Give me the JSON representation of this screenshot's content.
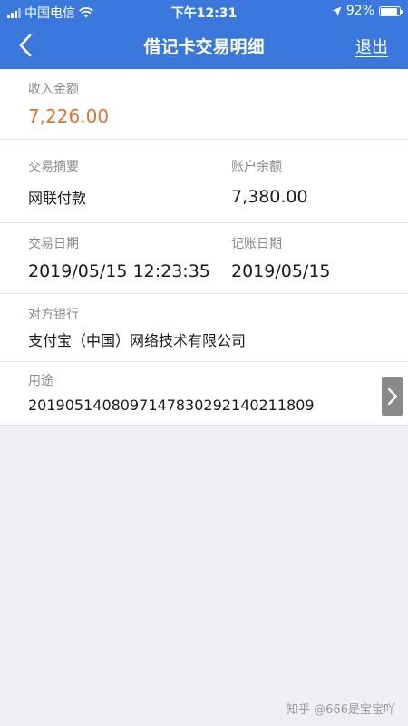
{
  "status_bar": {
    "carrier": "中国电信",
    "time": "下午12:31",
    "battery": "92%",
    "battery_level": 0.92
  },
  "nav": {
    "title": "借记卡交易明细",
    "exit": "退出"
  },
  "detail": {
    "income_label": "收入金额",
    "income_value": "7,226.00",
    "summary_label": "交易摘要",
    "summary_value": "网联付款",
    "balance_label": "账户余额",
    "balance_value": "7,380.00",
    "trade_date_label": "交易日期",
    "trade_date_value": "2019/05/15 12:23:35",
    "book_date_label": "记账日期",
    "book_date_value": "2019/05/15",
    "counterparty_label": "对方银行",
    "counterparty_value": "支付宝（中国）网络技术有限公司",
    "purpose_label": "用途",
    "purpose_value": "2019051408097147830292140211809"
  },
  "watermark": "知乎 @666是宝宝吖",
  "colors": {
    "header": "#3b78dd",
    "amount": "#e8722f"
  }
}
